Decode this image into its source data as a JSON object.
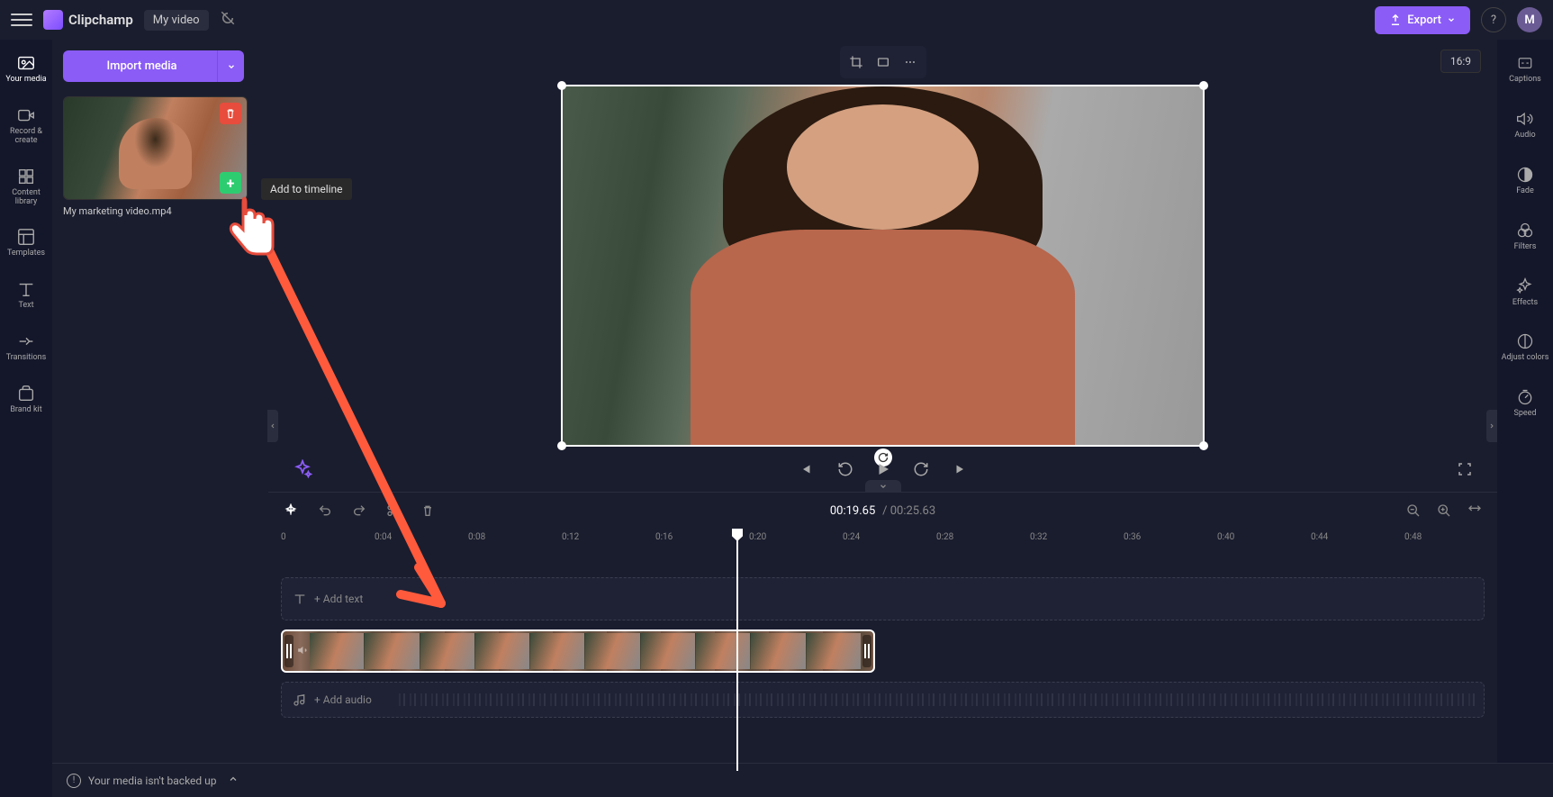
{
  "app": {
    "name": "Clipchamp",
    "video_title": "My video"
  },
  "topbar": {
    "export_label": "Export",
    "avatar_initial": "M"
  },
  "left_rail": [
    {
      "label": "Your media",
      "icon": "media"
    },
    {
      "label": "Record & create",
      "icon": "record"
    },
    {
      "label": "Content library",
      "icon": "library"
    },
    {
      "label": "Templates",
      "icon": "templates"
    },
    {
      "label": "Text",
      "icon": "text"
    },
    {
      "label": "Transitions",
      "icon": "transitions"
    },
    {
      "label": "Brand kit",
      "icon": "brandkit"
    }
  ],
  "media_panel": {
    "import_label": "Import media",
    "clip_name": "My marketing video.mp4",
    "tooltip": "Add to timeline"
  },
  "preview": {
    "aspect_label": "16:9"
  },
  "right_rail": [
    {
      "label": "Captions",
      "icon": "captions"
    },
    {
      "label": "Audio",
      "icon": "audio"
    },
    {
      "label": "Fade",
      "icon": "fade"
    },
    {
      "label": "Filters",
      "icon": "filters"
    },
    {
      "label": "Effects",
      "icon": "effects"
    },
    {
      "label": "Adjust colors",
      "icon": "adjust"
    },
    {
      "label": "Speed",
      "icon": "speed"
    }
  ],
  "timeline": {
    "current_time": "00:19.65",
    "duration": "00:25.63",
    "ruler": [
      "0",
      "0:04",
      "0:08",
      "0:12",
      "0:16",
      "0:20",
      "0:24",
      "0:28",
      "0:32",
      "0:36",
      "0:40",
      "0:44",
      "0:48"
    ],
    "add_text_label": "+ Add text",
    "add_audio_label": "+ Add audio"
  },
  "status": {
    "backup_warning": "Your media isn't backed up"
  }
}
